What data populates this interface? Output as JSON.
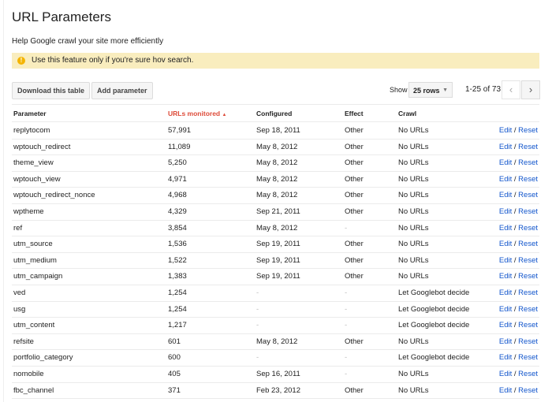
{
  "title": "URL Parameters",
  "subtitle": "Help Google crawl your site more efficiently",
  "warning": "Use this feature only if you're sure hov search.",
  "toolbar": {
    "download": "Download this table",
    "add": "Add parameter",
    "show": "Show",
    "rows": "25 rows",
    "range": "1-25 of 73",
    "prev": "‹",
    "next": "›"
  },
  "columns": [
    "Parameter",
    "URLs monitored",
    "Configured",
    "Effect",
    "Crawl"
  ],
  "sort_indicator": "▲",
  "actions": {
    "edit": "Edit",
    "sep": "/",
    "reset": "Reset"
  },
  "rows": [
    [
      "replytocom",
      "57,991",
      "Sep 18, 2011",
      "Other",
      "No URLs"
    ],
    [
      "wptouch_redirect",
      "11,089",
      "May 8, 2012",
      "Other",
      "No URLs"
    ],
    [
      "theme_view",
      "5,250",
      "May 8, 2012",
      "Other",
      "No URLs"
    ],
    [
      "wptouch_view",
      "4,971",
      "May 8, 2012",
      "Other",
      "No URLs"
    ],
    [
      "wptouch_redirect_nonce",
      "4,968",
      "May 8, 2012",
      "Other",
      "No URLs"
    ],
    [
      "wptheme",
      "4,329",
      "Sep 21, 2011",
      "Other",
      "No URLs"
    ],
    [
      "ref",
      "3,854",
      "May 8, 2012",
      "-",
      "No URLs"
    ],
    [
      "utm_source",
      "1,536",
      "Sep 19, 2011",
      "Other",
      "No URLs"
    ],
    [
      "utm_medium",
      "1,522",
      "Sep 19, 2011",
      "Other",
      "No URLs"
    ],
    [
      "utm_campaign",
      "1,383",
      "Sep 19, 2011",
      "Other",
      "No URLs"
    ],
    [
      "ved",
      "1,254",
      "-",
      "-",
      "Let Googlebot decide"
    ],
    [
      "usg",
      "1,254",
      "-",
      "-",
      "Let Googlebot decide"
    ],
    [
      "utm_content",
      "1,217",
      "-",
      "-",
      "Let Googlebot decide"
    ],
    [
      "refsite",
      "601",
      "May 8, 2012",
      "Other",
      "No URLs"
    ],
    [
      "portfolio_category",
      "600",
      "-",
      "-",
      "Let Googlebot decide"
    ],
    [
      "nomobile",
      "405",
      "Sep 16, 2011",
      "-",
      "No URLs"
    ],
    [
      "fbc_channel",
      "371",
      "Feb 23, 2012",
      "Other",
      "No URLs"
    ]
  ]
}
